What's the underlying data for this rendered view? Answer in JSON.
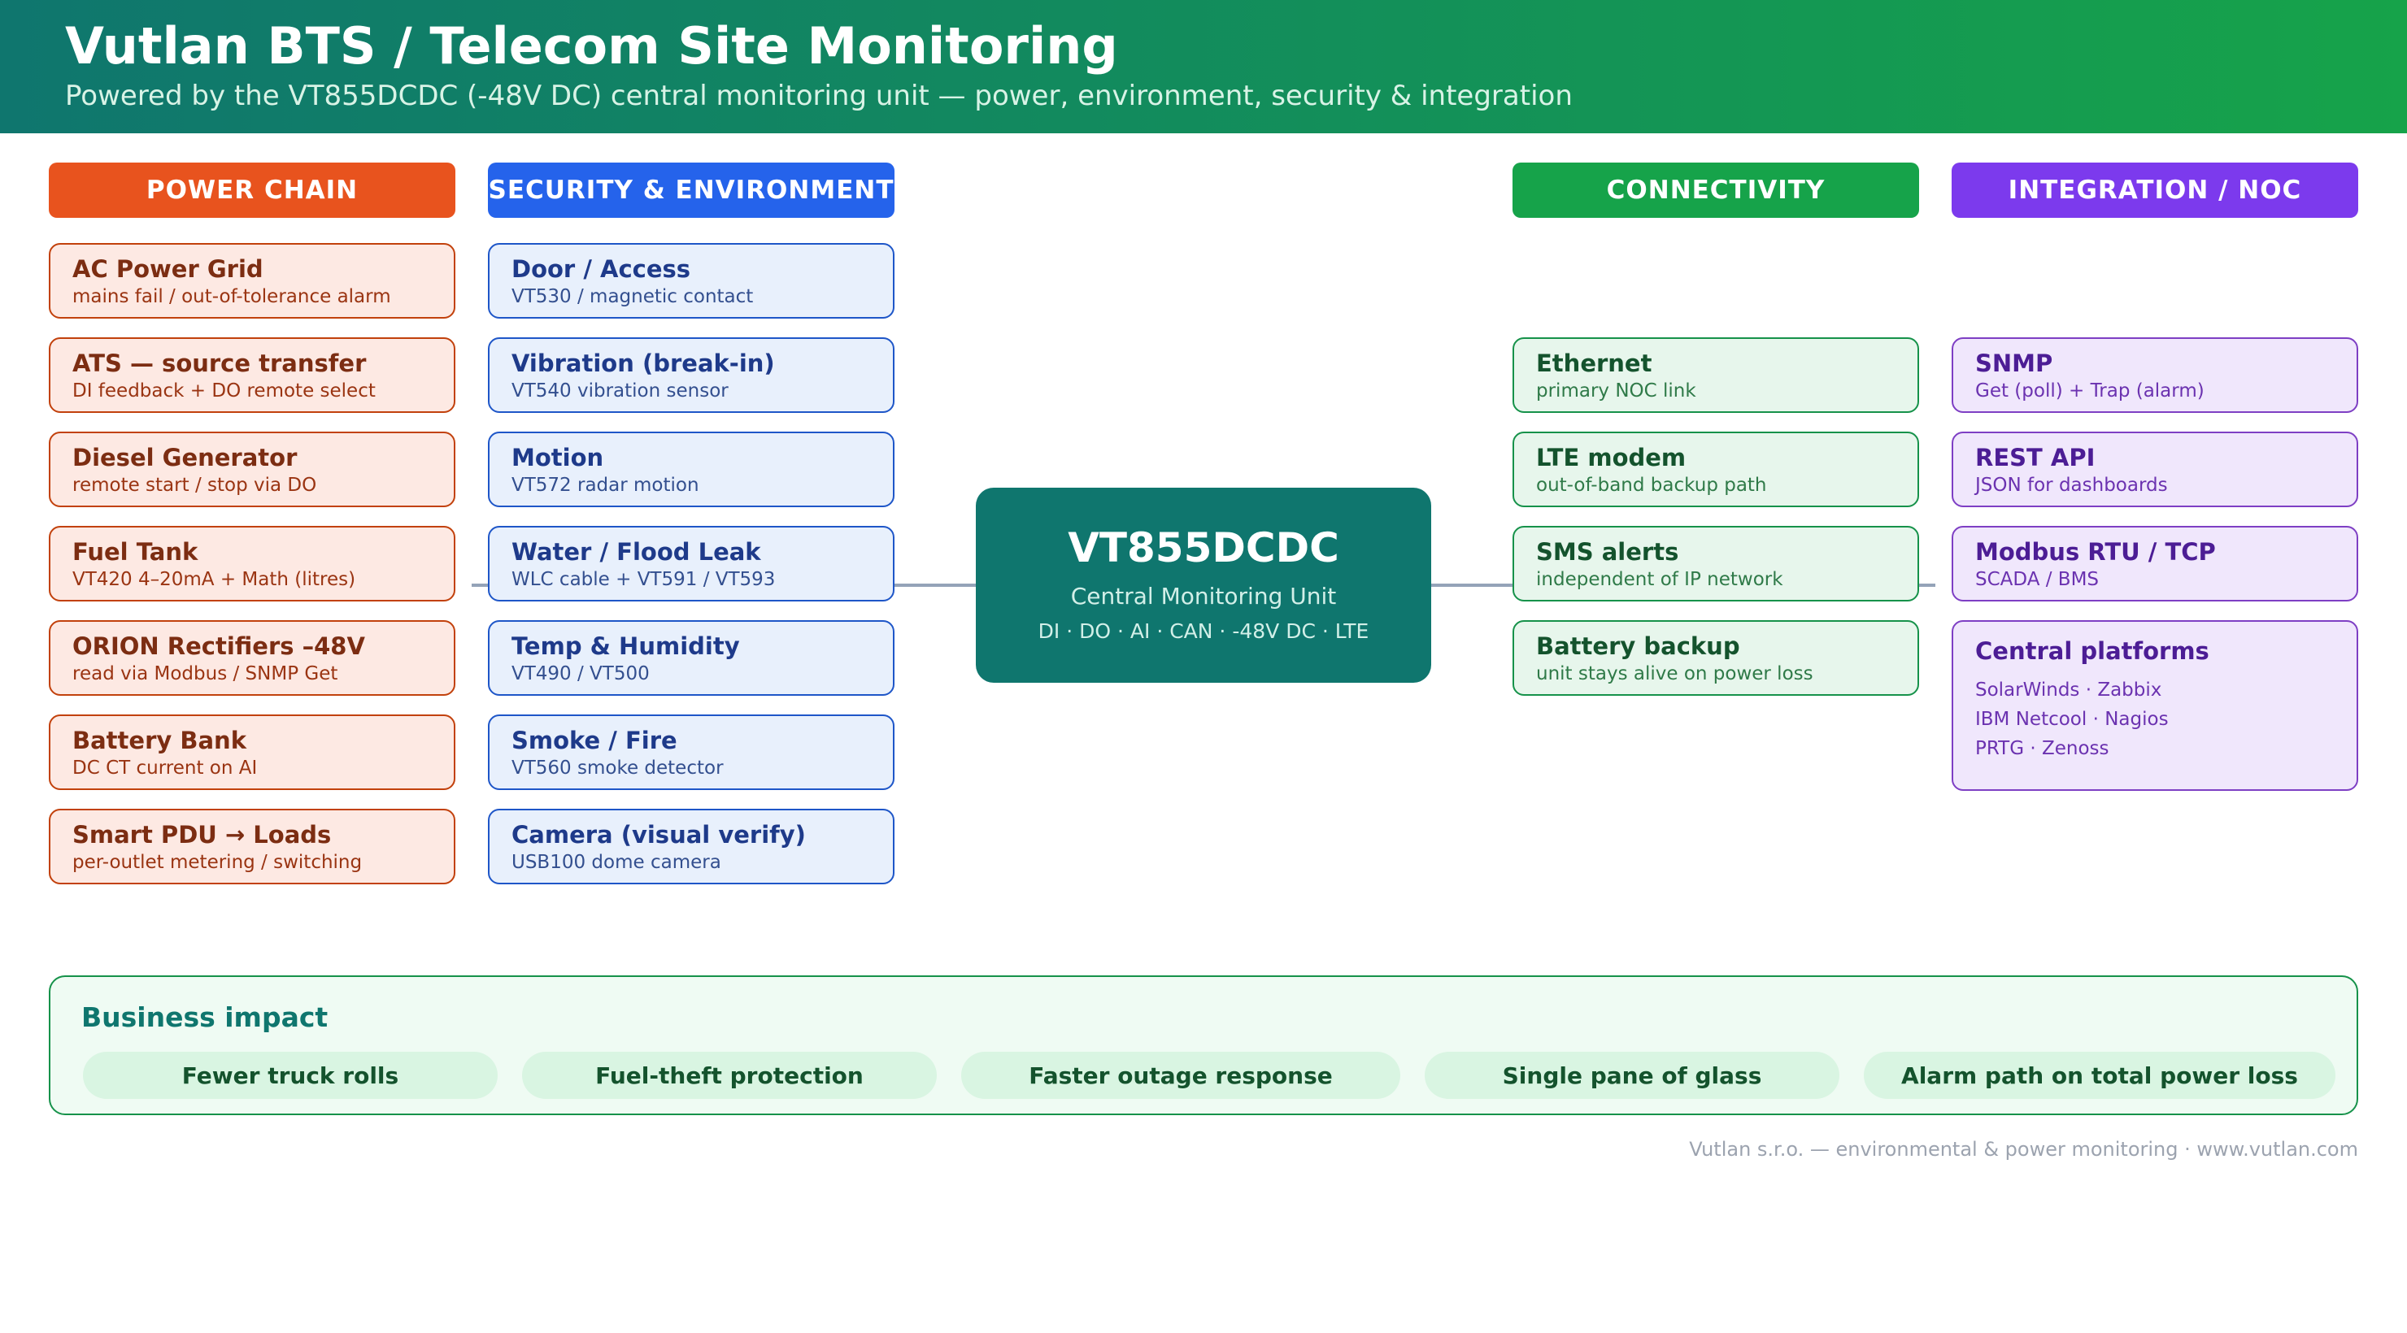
{
  "header": {
    "title": "Vutlan BTS / Telecom Site Monitoring",
    "subtitle": "Powered by the VT855DCDC (-48V DC) central monitoring unit — power, environment, security & integration"
  },
  "colors": {
    "power": "#e8531e",
    "security": "#2563eb",
    "connectivity": "#16a34a",
    "integration": "#7c3aed",
    "center": "#0f766e"
  },
  "columns": {
    "power": {
      "heading": "POWER CHAIN",
      "items": [
        {
          "title": "AC Power Grid",
          "sub": "mains fail / out-of-tolerance alarm"
        },
        {
          "title": "ATS — source transfer",
          "sub": "DI feedback + DO remote select"
        },
        {
          "title": "Diesel Generator",
          "sub": "remote start / stop via DO"
        },
        {
          "title": "Fuel Tank",
          "sub": "VT420 4–20mA + Math (litres)"
        },
        {
          "title": "ORION Rectifiers –48V",
          "sub": "read via Modbus / SNMP Get"
        },
        {
          "title": "Battery Bank",
          "sub": "DC CT current on AI"
        },
        {
          "title": "Smart PDU → Loads",
          "sub": "per-outlet metering / switching"
        }
      ]
    },
    "security": {
      "heading": "SECURITY & ENVIRONMENT",
      "items": [
        {
          "title": "Door / Access",
          "sub": "VT530 / magnetic contact"
        },
        {
          "title": "Vibration (break-in)",
          "sub": "VT540 vibration sensor"
        },
        {
          "title": "Motion",
          "sub": "VT572 radar motion"
        },
        {
          "title": "Water / Flood Leak",
          "sub": "WLC cable + VT591 / VT593"
        },
        {
          "title": "Temp & Humidity",
          "sub": "VT490 / VT500"
        },
        {
          "title": "Smoke / Fire",
          "sub": "VT560 smoke detector"
        },
        {
          "title": "Camera (visual verify)",
          "sub": "USB100 dome camera"
        }
      ]
    },
    "connectivity": {
      "heading": "CONNECTIVITY",
      "items": [
        {
          "title": "Ethernet",
          "sub": "primary NOC link"
        },
        {
          "title": "LTE modem",
          "sub": "out-of-band backup path"
        },
        {
          "title": "SMS alerts",
          "sub": "independent of IP network"
        },
        {
          "title": "Battery backup",
          "sub": "unit stays alive on power loss"
        }
      ]
    },
    "integration": {
      "heading": "INTEGRATION / NOC",
      "items": [
        {
          "title": "SNMP",
          "sub": "Get (poll) + Trap (alarm)"
        },
        {
          "title": "REST API",
          "sub": "JSON for dashboards"
        },
        {
          "title": "Modbus RTU / TCP",
          "sub": "SCADA / BMS"
        }
      ],
      "platforms": {
        "title": "Central platforms",
        "lines": [
          "SolarWinds · Zabbix",
          "IBM Netcool · Nagios",
          "PRTG · Zenoss"
        ]
      }
    }
  },
  "center": {
    "title": "VT855DCDC",
    "subtitle": "Central Monitoring Unit",
    "tags": "DI · DO · AI · CAN · -48V DC · LTE"
  },
  "impact": {
    "title": "Business impact",
    "items": [
      "Fewer truck rolls",
      "Fuel-theft protection",
      "Faster outage response",
      "Single pane of glass",
      "Alarm path on total power loss"
    ]
  },
  "footer": "Vutlan s.r.o. — environmental & power monitoring · www.vutlan.com"
}
